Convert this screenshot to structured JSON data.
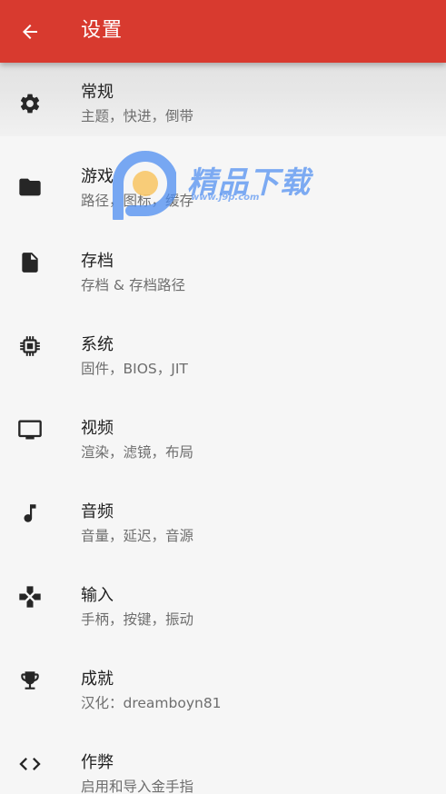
{
  "appbar": {
    "title": "设置",
    "back_icon": "arrow-back-icon",
    "color": "#d83a2f"
  },
  "settings": [
    {
      "icon": "gear-icon",
      "label": "常规",
      "subtitle": "主题，快进，倒带"
    },
    {
      "icon": "folder-icon",
      "label": "游戏",
      "subtitle": "路径，图标，缓存"
    },
    {
      "icon": "file-icon",
      "label": "存档",
      "subtitle": "存档 & 存档路径"
    },
    {
      "icon": "chip-icon",
      "label": "系统",
      "subtitle": "固件，BIOS，JIT"
    },
    {
      "icon": "monitor-icon",
      "label": "视频",
      "subtitle": "渲染，滤镜，布局"
    },
    {
      "icon": "music-note-icon",
      "label": "音频",
      "subtitle": "音量，延迟，音源"
    },
    {
      "icon": "gamepad-icon",
      "label": "输入",
      "subtitle": "手柄，按键，振动"
    },
    {
      "icon": "trophy-icon",
      "label": "成就",
      "subtitle": "汉化：dreamboyn81"
    },
    {
      "icon": "code-icon",
      "label": "作弊",
      "subtitle": "启用和导入金手指"
    }
  ],
  "watermark": {
    "text": "精品下载",
    "url": "www.j9p.com",
    "color": "#5a95f2"
  }
}
